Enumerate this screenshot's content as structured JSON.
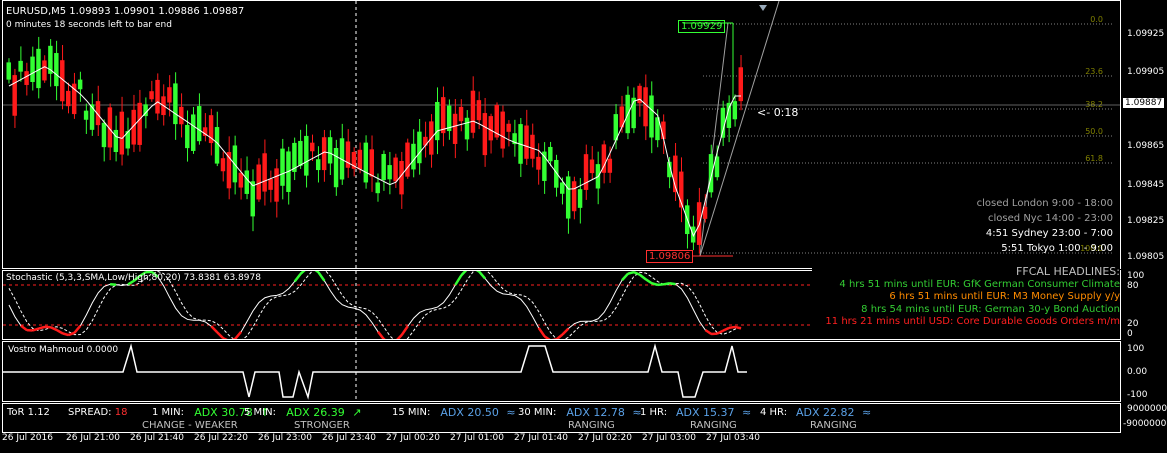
{
  "window": {
    "symbol_line": "EURUSD,M5  1.09893 1.09901 1.09886 1.09887",
    "bar_timer": "0 minutes 18 seconds left to bar end"
  },
  "price_axis": {
    "ticks": [
      "1.09925",
      "1.09905",
      "1.09887",
      "1.09865",
      "1.09845",
      "1.09825",
      "1.09805"
    ],
    "current_price": "1.09887",
    "countdown": "0:18"
  },
  "fibo": {
    "levels": [
      "0.0",
      "23.6",
      "38.2",
      "50.0",
      "61.8",
      "100.0"
    ],
    "high_label": "1.09929",
    "low_label": "1.09806"
  },
  "sessions": [
    {
      "text": "closed London 9:00 - 18:00",
      "color": "#a0a0a0"
    },
    {
      "text": "closed Nyc 14:00 - 23:00",
      "color": "#a0a0a0"
    },
    {
      "text": "4:51 Sydney 23:00 - 7:00",
      "color": "#ffffff"
    },
    {
      "text": "5:51 Tokyo 1:00 - 9:00",
      "color": "#ffffff"
    }
  ],
  "stochastic": {
    "label": "Stochastic (5,3,3,SMA,Low/High,80,20) 73.8381 63.8978",
    "axis": [
      "100",
      "80",
      "20",
      "0"
    ]
  },
  "news": {
    "title": "FFCAL HEADLINES:",
    "items": [
      {
        "text": "4 hrs 51 mins until EUR: GfK German Consumer Climate",
        "color": "#33cc33"
      },
      {
        "text": "6 hrs 51 mins until EUR: M3 Money Supply y/y",
        "color": "#ff8c00"
      },
      {
        "text": "8 hrs 54 mins until EUR: German 30-y Bond Auction",
        "color": "#33cc33"
      },
      {
        "text": "11 hrs 21 mins until USD: Core Durable Goods Orders m/m",
        "color": "#ff2020"
      }
    ]
  },
  "vostro": {
    "label": "Vostro Mahmoud 0.0000",
    "axis": [
      "100",
      "0.00",
      "-100"
    ]
  },
  "tor": {
    "label": "ToR 1.12",
    "spread_label": "SPREAD:",
    "spread_value": "18",
    "items": [
      {
        "tf": "1 MIN:",
        "adx": "ADX 30.78",
        "arrow": "↑",
        "color": "#33ff33",
        "state": "CHANGE - WEAKER"
      },
      {
        "tf": "5 MIN:",
        "adx": "ADX 26.39",
        "arrow": "↗",
        "color": "#33ff33",
        "state": "STRONGER"
      },
      {
        "tf": "15 MIN:",
        "adx": "ADX 20.50",
        "arrow": "≈",
        "color": "#5aa0e6",
        "state": ""
      },
      {
        "tf": "30 MIN:",
        "adx": "ADX 12.78",
        "arrow": "≈",
        "color": "#5aa0e6",
        "state": "RANGING"
      },
      {
        "tf": "1 HR:",
        "adx": "ADX 15.37",
        "arrow": "≈",
        "color": "#5aa0e6",
        "state": "RANGING"
      },
      {
        "tf": "4 HR:",
        "adx": "ADX 22.82",
        "arrow": "≈",
        "color": "#5aa0e6",
        "state": "RANGING"
      }
    ],
    "axis": [
      "9000000",
      "-9000000"
    ]
  },
  "time_axis": [
    "26 Jul 2016",
    "26 Jul 21:00",
    "26 Jul 21:40",
    "26 Jul 22:20",
    "26 Jul 23:00",
    "26 Jul 23:40",
    "27 Jul 00:20",
    "27 Jul 01:00",
    "27 Jul 01:40",
    "27 Jul 02:20",
    "27 Jul 03:00",
    "27 Jul 03:40"
  ],
  "colors": {
    "bull": "#33ff33",
    "bear": "#ff1a1a",
    "grid": "#808080",
    "fib": "#808000"
  }
}
